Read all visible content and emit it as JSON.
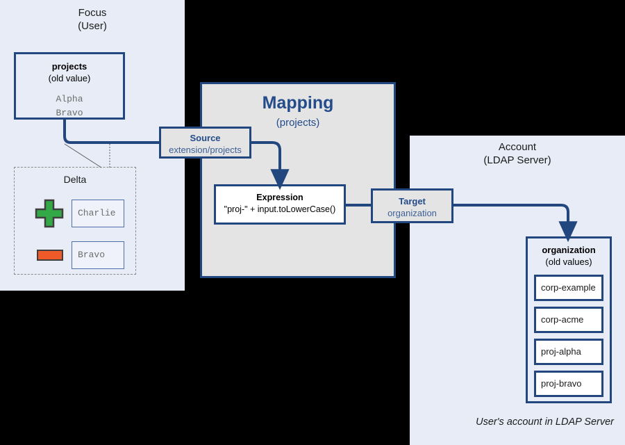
{
  "focus": {
    "title": "Focus",
    "subtitle": "(User)",
    "attribute": {
      "name": "projects",
      "qualifier": "(old value)",
      "values": [
        "Alpha",
        "Bravo"
      ]
    },
    "delta": {
      "title": "Delta",
      "rows": [
        {
          "op": "add",
          "icon": "plus-icon",
          "value": "Charlie"
        },
        {
          "op": "delete",
          "icon": "minus-icon",
          "value": "Bravo"
        }
      ]
    }
  },
  "mapping": {
    "title": "Mapping",
    "subtitle": "(projects)",
    "source": {
      "label": "Source",
      "value": "extension/projects"
    },
    "expression": {
      "label": "Expression",
      "value": "\"proj-\" + input.toLowerCase()"
    },
    "target": {
      "label": "Target",
      "value": "organization"
    }
  },
  "account": {
    "title": "Account",
    "subtitle": "(LDAP Server)",
    "attribute": {
      "name": "organization",
      "qualifier": "(old values)",
      "values": [
        "corp-example",
        "corp-acme",
        "proj-alpha",
        "proj-bravo"
      ]
    },
    "caption": "User's account in LDAP Server"
  },
  "colors": {
    "panel_fill": "#e8ecf7",
    "mapping_fill": "#e4e4e4",
    "stroke_blue": "#22477f",
    "title_blue": "#244b8a",
    "add_green": "#33a846",
    "delete_orange": "#ef5a28",
    "mono_gray": "#6d6d6d",
    "background": "#000000"
  }
}
